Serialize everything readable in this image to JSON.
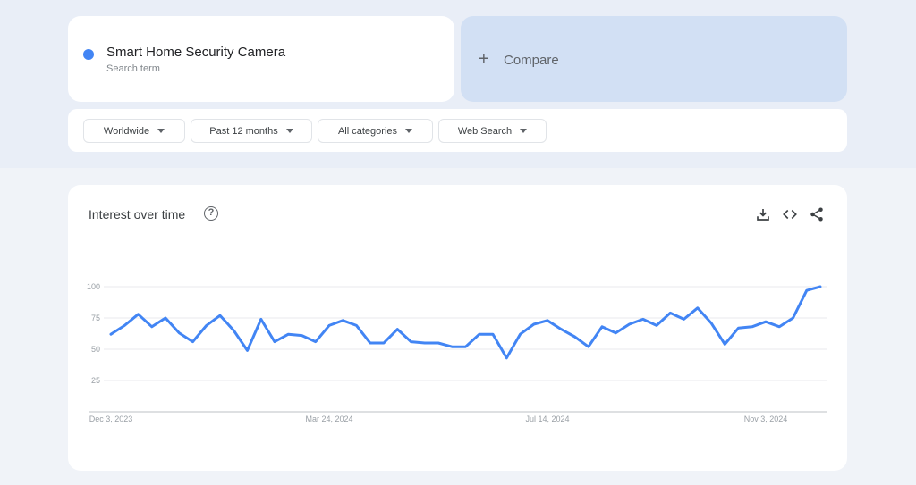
{
  "search_term": {
    "title": "Smart Home Security Camera",
    "subtitle": "Search term",
    "color": "#4285f4"
  },
  "compare": {
    "icon": "plus-icon",
    "label": "Compare"
  },
  "filters": [
    {
      "label": "Worldwide"
    },
    {
      "label": "Past 12 months"
    },
    {
      "label": "All categories"
    },
    {
      "label": "Web Search"
    }
  ],
  "chart_card": {
    "title": "Interest over time",
    "help_icon": "help-circle-icon",
    "actions": [
      "download-icon",
      "embed-code-icon",
      "share-icon"
    ]
  },
  "chart_data": {
    "type": "line",
    "title": "Interest over time",
    "xlabel": "",
    "ylabel": "",
    "ylim": [
      0,
      100
    ],
    "yticks": [
      25,
      50,
      75,
      100
    ],
    "grid": true,
    "x_tick_labels": [
      {
        "label": "Dec 3, 2023",
        "index": 0
      },
      {
        "label": "Mar 24, 2024",
        "index": 16
      },
      {
        "label": "Jul 14, 2024",
        "index": 32
      },
      {
        "label": "Nov 3, 2024",
        "index": 48
      }
    ],
    "series": [
      {
        "name": "Smart Home Security Camera",
        "color": "#4285f4",
        "frequency": "weekly",
        "start": "Dec 3, 2023",
        "values": [
          62,
          69,
          78,
          68,
          75,
          63,
          56,
          69,
          77,
          65,
          49,
          74,
          56,
          62,
          61,
          56,
          69,
          73,
          69,
          55,
          55,
          66,
          56,
          55,
          55,
          52,
          52,
          62,
          62,
          43,
          62,
          70,
          73,
          66,
          60,
          52,
          68,
          63,
          70,
          74,
          69,
          79,
          74,
          83,
          71,
          54,
          67,
          68,
          72,
          68,
          75,
          97,
          100
        ]
      }
    ]
  }
}
